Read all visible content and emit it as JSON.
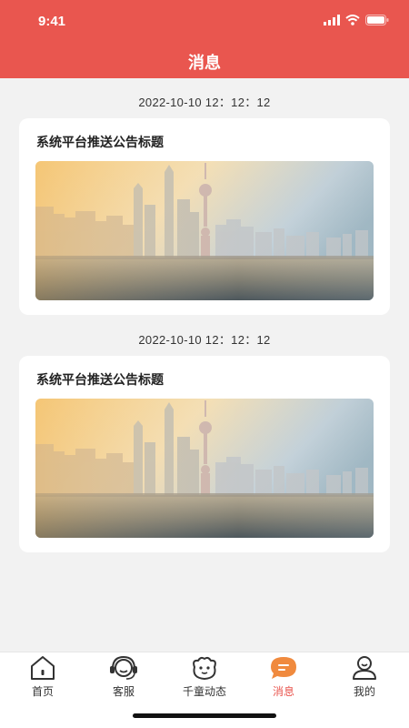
{
  "status_bar": {
    "time": "9:41"
  },
  "header": {
    "title": "消息"
  },
  "messages": [
    {
      "timestamp": "2022-10-10 12：12：12",
      "title": "系统平台推送公告标题",
      "image": "city-skyline-image"
    },
    {
      "timestamp": "2022-10-10 12：12：12",
      "title": "系统平台推送公告标题",
      "image": "city-skyline-image"
    }
  ],
  "tabbar": {
    "active": "消息",
    "items": [
      {
        "label": "首页",
        "icon": "home-icon"
      },
      {
        "label": "客服",
        "icon": "headset-icon"
      },
      {
        "label": "千童动态",
        "icon": "child-face-icon"
      },
      {
        "label": "消息",
        "icon": "message-icon"
      },
      {
        "label": "我的",
        "icon": "user-icon"
      }
    ]
  },
  "colors": {
    "brand": "#e9564f",
    "background": "#f2f2f2",
    "active_tab": "#e9564f"
  }
}
